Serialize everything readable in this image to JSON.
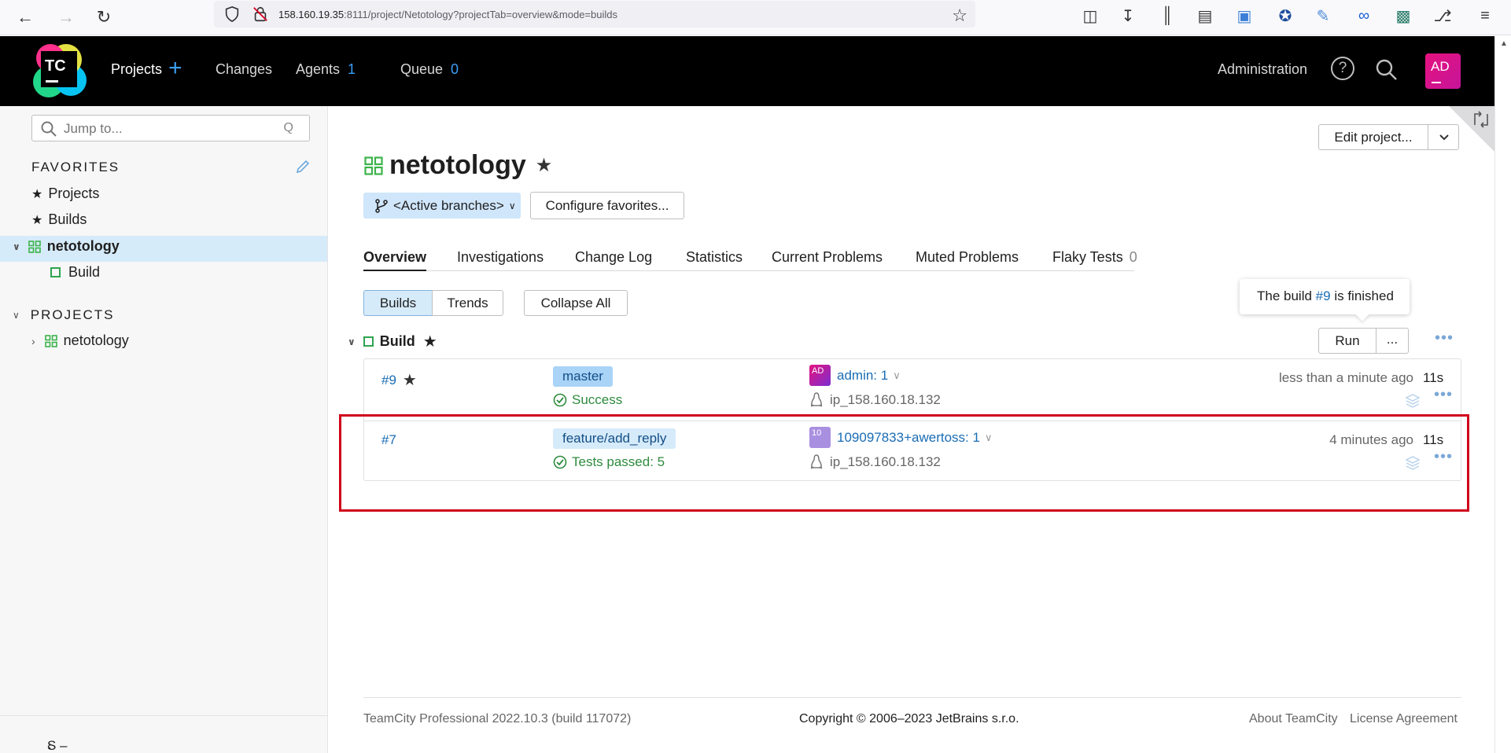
{
  "browser": {
    "url_host": "158.160.19.35",
    "url_rest": ":8111/project/Netotology?projectTab=overview&mode=builds"
  },
  "header": {
    "nav": {
      "projects": "Projects",
      "changes": "Changes",
      "agents": "Agents",
      "agents_count": "1",
      "queue": "Queue",
      "queue_count": "0"
    },
    "logo_text": "TC",
    "administration": "Administration",
    "avatar_initials": "AD"
  },
  "sidebar": {
    "search_placeholder": "Jump to...",
    "favorites_heading": "FAVORITES",
    "favorites": [
      "Projects",
      "Builds"
    ],
    "tree_project": "netotology",
    "tree_build": "Build",
    "projects_heading": "PROJECTS",
    "projects": [
      "netotology"
    ],
    "hide_sidebar": "S – hide sidebar"
  },
  "project": {
    "title": "netotology",
    "edit_button": "Edit project...",
    "branch_selector": "<Active branches>",
    "configure_favorites": "Configure favorites...",
    "tabs": [
      "Overview",
      "Investigations",
      "Change Log",
      "Statistics",
      "Current Problems",
      "Muted Problems",
      "Flaky Tests"
    ],
    "flaky_count": "0",
    "view_toggle": [
      "Builds",
      "Trends"
    ],
    "collapse_all": "Collapse All"
  },
  "tooltip": {
    "prefix": "The build ",
    "link": "#9",
    "suffix": " is finished"
  },
  "build_config": {
    "name": "Build",
    "run_button": "Run",
    "run_more": "..."
  },
  "builds": [
    {
      "number": "#9",
      "branch": "master",
      "status": "Success",
      "user": "admin: 1",
      "user_avatar": "AD",
      "agent": "ip_158.160.18.132",
      "time": "less than a minute ago",
      "duration": "11s"
    },
    {
      "number": "#7",
      "branch": "feature/add_reply",
      "status": "Tests passed: 5",
      "user": "109097833+awertoss: 1",
      "user_avatar": "10",
      "agent": "ip_158.160.18.132",
      "time": "4 minutes ago",
      "duration": "11s"
    }
  ],
  "footer": {
    "version": "TeamCity Professional 2022.10.3 (build 117072)",
    "copyright": "Copyright © 2006–2023 JetBrains s.r.o.",
    "about": "About TeamCity",
    "license": "License Agreement"
  },
  "colors": {
    "accent": "#3b9ef5",
    "link": "#1a6db5",
    "success": "#2e8b3e",
    "highlight_box": "#d0021b"
  }
}
